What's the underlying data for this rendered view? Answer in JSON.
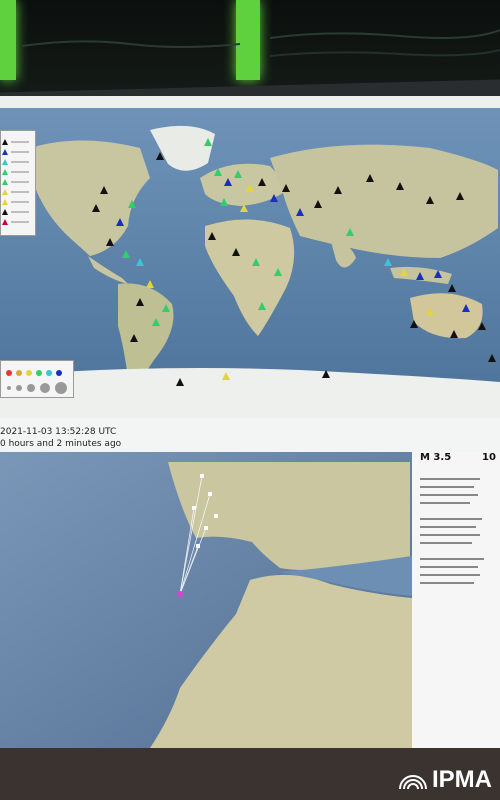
{
  "event": {
    "datetime": "2021-11-03 13:52:28 UTC",
    "ago": "0 hours and 2 minutes ago",
    "magnitude": "M 3.5",
    "depth": "10 "
  },
  "logo": {
    "text": "IPMA"
  },
  "colors": {
    "ocean": "#5d82a8",
    "land": "#c9c7a2",
    "ice": "#eef0ee",
    "triangle_black": "#111111",
    "triangle_blue": "#1b2fbd",
    "triangle_green": "#2fcf6a",
    "triangle_yellow": "#e2d53b",
    "triangle_cyan": "#36c6d6",
    "epicenter": "#e23fd2"
  },
  "icons": [
    "triangle-station-icon",
    "epicenter-marker-icon",
    "ipma-waves-icon"
  ]
}
